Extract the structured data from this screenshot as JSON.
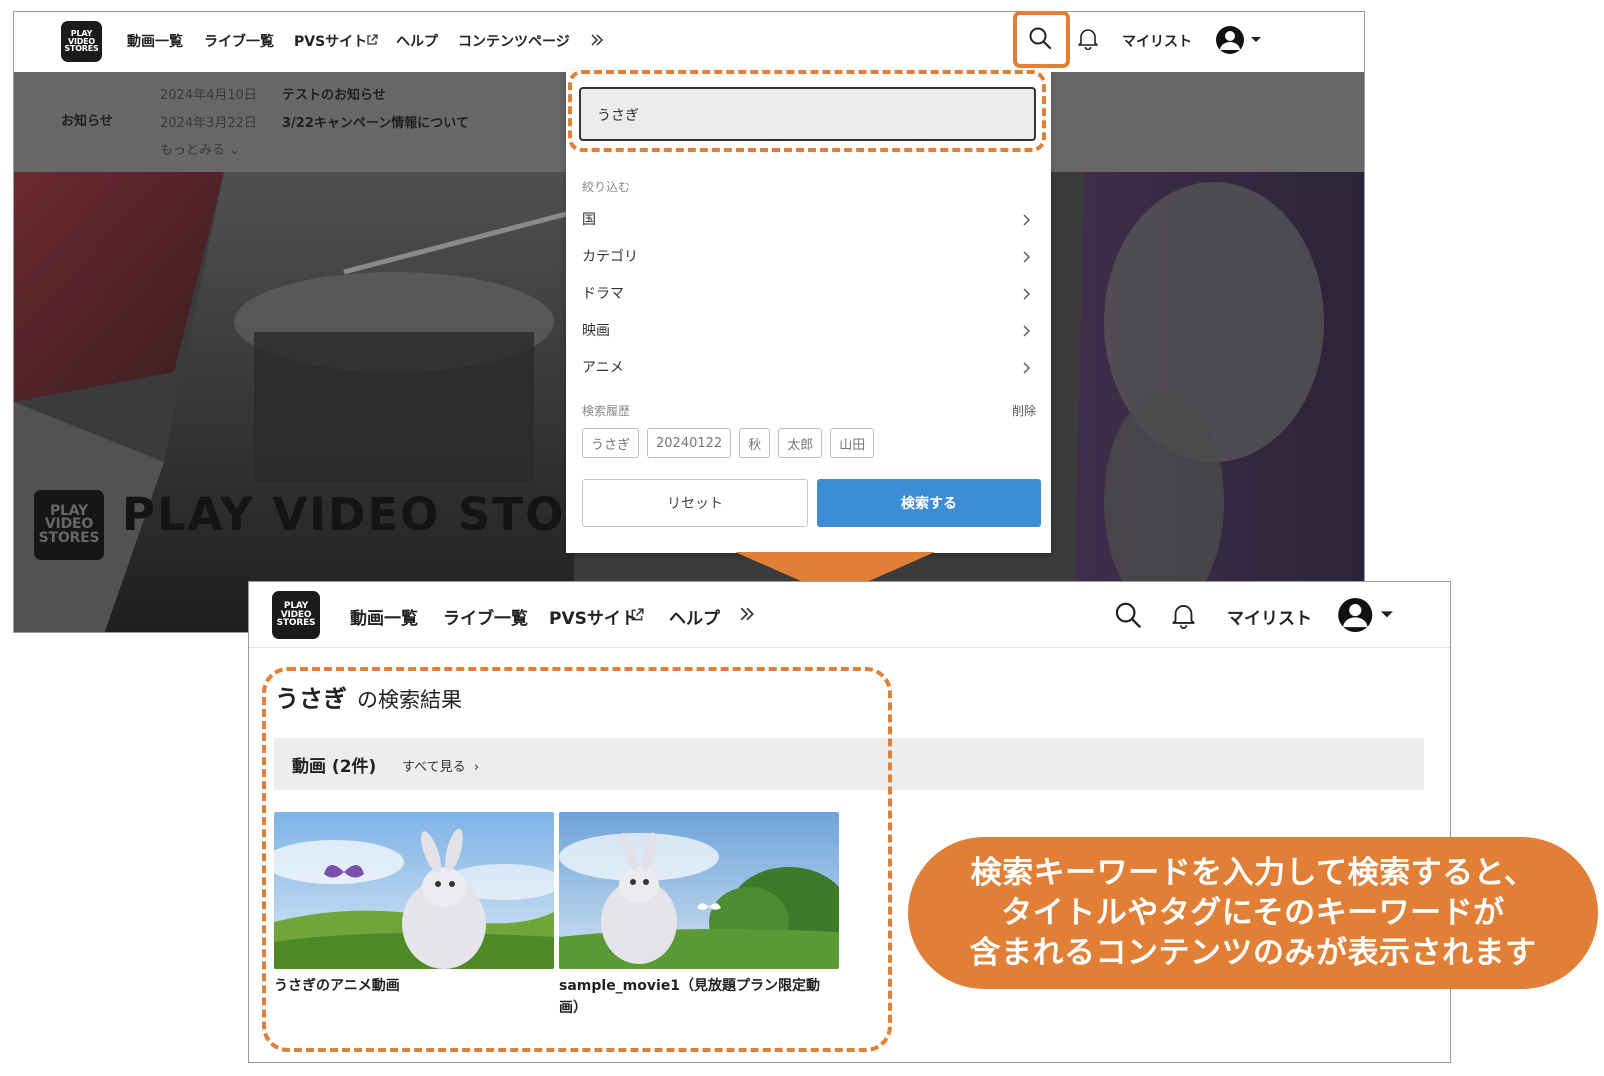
{
  "brand": {
    "logo_lines": [
      "PLAY",
      "VIDEO",
      "STORES"
    ],
    "hero_name": "PLAY VIDEO STOR"
  },
  "top_screen": {
    "nav": [
      "動画一覧",
      "ライブ一覧",
      "PVSサイト",
      "ヘルプ",
      "コンテンツページ"
    ],
    "mylist": "マイリスト",
    "news": {
      "label": "お知らせ",
      "items": [
        {
          "date": "2024年4月10日",
          "title": "テストのお知らせ"
        },
        {
          "date": "2024年3月22日",
          "title": "3/22キャンペーン情報について"
        }
      ],
      "more": "もっとみる"
    },
    "search": {
      "value": "うさぎ",
      "filter_label": "絞り込む",
      "filters": [
        "国",
        "カテゴリ",
        "ドラマ",
        "映画",
        "アニメ"
      ],
      "history_label": "検索履歴",
      "history_delete": "削除",
      "history": [
        "うさぎ",
        "20240122",
        "秋",
        "太郎",
        "山田"
      ],
      "reset_label": "リセット",
      "submit_label": "検索する"
    }
  },
  "bottom_screen": {
    "nav": [
      "動画一覧",
      "ライブ一覧",
      "PVSサイト",
      "ヘルプ"
    ],
    "mylist": "マイリスト",
    "result_keyword": "うさぎ",
    "result_suffix": "の検索結果",
    "category_heading": "動画 (2件)",
    "see_all": "すべて見る",
    "videos": [
      {
        "title": "うさぎのアニメ動画"
      },
      {
        "title": "sample_movie1（見放題プラン限定動画）"
      }
    ]
  },
  "callout": {
    "lines": [
      "検索キーワードを入力して検索すると、",
      "タイトルやタグにそのキーワードが",
      "含まれるコンテンツのみが表示されます"
    ]
  },
  "colors": {
    "accent_orange": "#e07f35",
    "primary_blue": "#3d8dd5"
  }
}
